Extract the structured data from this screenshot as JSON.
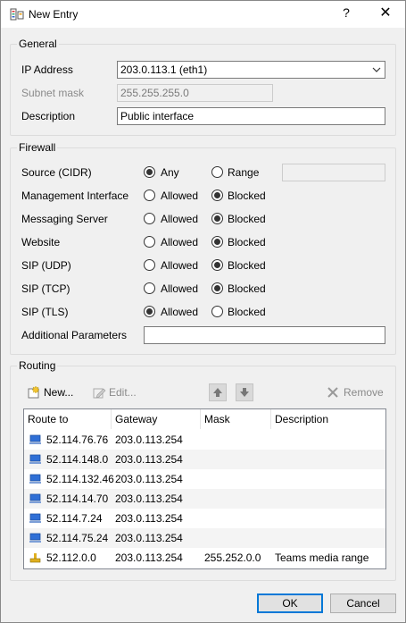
{
  "window": {
    "title": "New Entry",
    "help_label": "?",
    "close_label": "✕",
    "icon": "network-config-icon"
  },
  "general": {
    "title": "General",
    "ip_label": "IP Address",
    "ip_value": "203.0.113.1 (eth1)",
    "subnet_label": "Subnet mask",
    "subnet_value": "255.255.255.0",
    "description_label": "Description",
    "description_value": "Public interface"
  },
  "firewall": {
    "title": "Firewall",
    "source_label": "Source (CIDR)",
    "source_any": "Any",
    "source_range": "Range",
    "source_selected": "Any",
    "rules": [
      {
        "label": "Management Interface",
        "allowed": "Allowed",
        "blocked": "Blocked",
        "selected": "Blocked"
      },
      {
        "label": "Messaging Server",
        "allowed": "Allowed",
        "blocked": "Blocked",
        "selected": "Blocked"
      },
      {
        "label": "Website",
        "allowed": "Allowed",
        "blocked": "Blocked",
        "selected": "Blocked"
      },
      {
        "label": "SIP (UDP)",
        "allowed": "Allowed",
        "blocked": "Blocked",
        "selected": "Blocked"
      },
      {
        "label": "SIP (TCP)",
        "allowed": "Allowed",
        "blocked": "Blocked",
        "selected": "Blocked"
      },
      {
        "label": "SIP (TLS)",
        "allowed": "Allowed",
        "blocked": "Blocked",
        "selected": "Allowed"
      }
    ],
    "additional_label": "Additional Parameters",
    "additional_value": ""
  },
  "routing": {
    "title": "Routing",
    "new_label": "New...",
    "edit_label": "Edit...",
    "remove_label": "Remove",
    "up_icon": "arrow-up-icon",
    "down_icon": "arrow-down-icon",
    "columns": [
      "Route to",
      "Gateway",
      "Mask",
      "Description"
    ],
    "rows": [
      {
        "route": "52.114.76.76",
        "gateway": "203.0.113.254",
        "mask": "",
        "description": "",
        "icon": "network-route-icon"
      },
      {
        "route": "52.114.148.0",
        "gateway": "203.0.113.254",
        "mask": "",
        "description": "",
        "icon": "network-route-icon"
      },
      {
        "route": "52.114.132.46",
        "gateway": "203.0.113.254",
        "mask": "",
        "description": "",
        "icon": "network-route-icon"
      },
      {
        "route": "52.114.14.70",
        "gateway": "203.0.113.254",
        "mask": "",
        "description": "",
        "icon": "network-route-icon"
      },
      {
        "route": "52.114.7.24",
        "gateway": "203.0.113.254",
        "mask": "",
        "description": "",
        "icon": "network-route-icon"
      },
      {
        "route": "52.114.75.24",
        "gateway": "203.0.113.254",
        "mask": "",
        "description": "",
        "icon": "network-route-icon"
      },
      {
        "route": "52.112.0.0",
        "gateway": "203.0.113.254",
        "mask": "255.252.0.0",
        "description": "Teams media range",
        "icon": "subnet-route-icon"
      }
    ]
  },
  "footer": {
    "ok_label": "OK",
    "cancel_label": "Cancel"
  },
  "colors": {
    "accent": "#0078d7",
    "route_icon_blue": "#2f6fd6",
    "subnet_icon_yellow": "#e0b020"
  }
}
